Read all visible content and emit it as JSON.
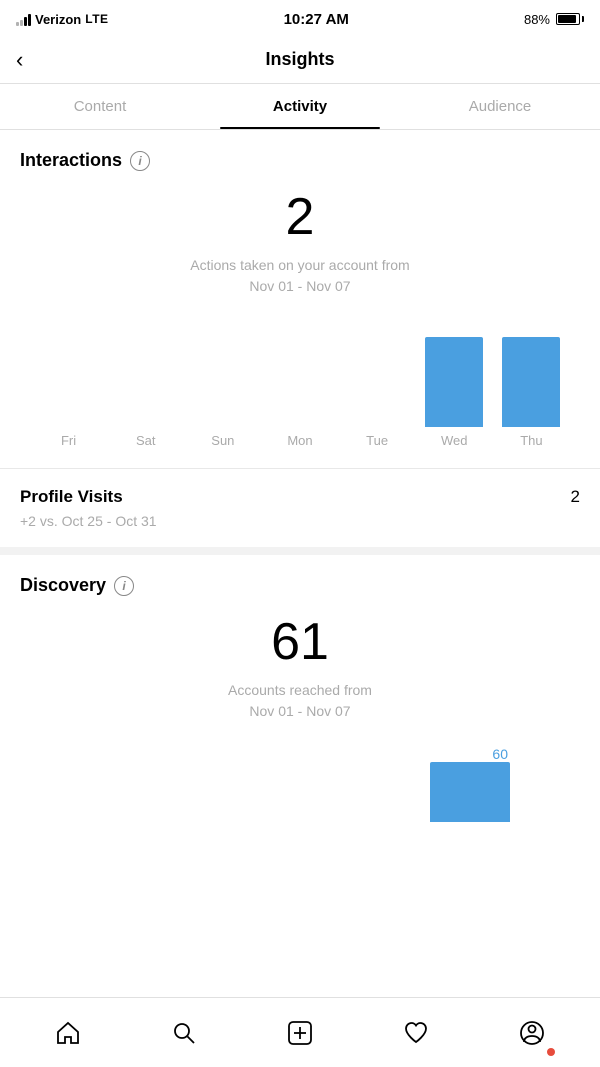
{
  "statusBar": {
    "carrier": "Verizon",
    "networkType": "LTE",
    "time": "10:27 AM",
    "battery": "88%"
  },
  "header": {
    "title": "Insights",
    "backLabel": "‹"
  },
  "tabs": [
    {
      "id": "content",
      "label": "Content",
      "active": false
    },
    {
      "id": "activity",
      "label": "Activity",
      "active": true
    },
    {
      "id": "audience",
      "label": "Audience",
      "active": false
    }
  ],
  "interactions": {
    "sectionTitle": "Interactions",
    "count": "2",
    "subtitle": "Actions taken on your account from\nNov 01 - Nov 07",
    "chart": {
      "days": [
        "Fri",
        "Sat",
        "Sun",
        "Mon",
        "Tue",
        "Wed",
        "Thu"
      ],
      "values": [
        0,
        0,
        0,
        0,
        0,
        1,
        1
      ],
      "maxHeight": 90,
      "barColor": "#4A9FE0"
    }
  },
  "profileVisits": {
    "label": "Profile Visits",
    "count": "2",
    "comparison": "+2 vs. Oct 25 - Oct 31"
  },
  "discovery": {
    "sectionTitle": "Discovery",
    "count": "61",
    "subtitle": "Accounts reached from\nNov 01 - Nov 07",
    "partialBarValue": "60",
    "barColor": "#4A9FE0"
  },
  "bottomNav": {
    "items": [
      {
        "id": "home",
        "icon": "home-icon"
      },
      {
        "id": "search",
        "icon": "search-icon"
      },
      {
        "id": "add",
        "icon": "add-icon"
      },
      {
        "id": "heart",
        "icon": "heart-icon"
      },
      {
        "id": "profile",
        "icon": "profile-icon"
      }
    ]
  }
}
